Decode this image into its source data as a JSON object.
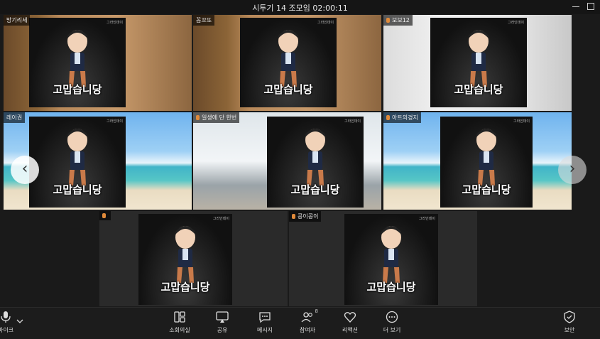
{
  "window": {
    "title": "시투기 14 조모임 02:00:11"
  },
  "caption_text": "고맙습니당",
  "mini_tag_text": "그라인데이",
  "participants": [
    {
      "name": "방기리세"
    },
    {
      "name": "꼼꼬또"
    },
    {
      "name": "보보12"
    },
    {
      "name": "레이권"
    },
    {
      "name": "일생에 단 한번"
    },
    {
      "name": "아트의경지"
    },
    {
      "name": ""
    },
    {
      "name": "콩이콩이"
    }
  ],
  "toolbar": {
    "mic": "마이크",
    "breakout": "소회의실",
    "share": "공유",
    "chat": "메시지",
    "participants": "참여자",
    "participants_count": "8",
    "reactions": "리액션",
    "more": "더 보기",
    "security": "보안"
  },
  "icons": [
    "microphone-icon",
    "chevron-down-icon",
    "breakout-rooms-icon",
    "share-screen-icon",
    "chat-icon",
    "participants-icon",
    "heart-icon",
    "more-icon",
    "shield-icon",
    "chevron-left-icon",
    "chevron-right-icon"
  ],
  "colors": {
    "active_speaker": "#27d46a",
    "active_speaker_alt": "#2fd8c8",
    "accent": "#e08a3a"
  }
}
